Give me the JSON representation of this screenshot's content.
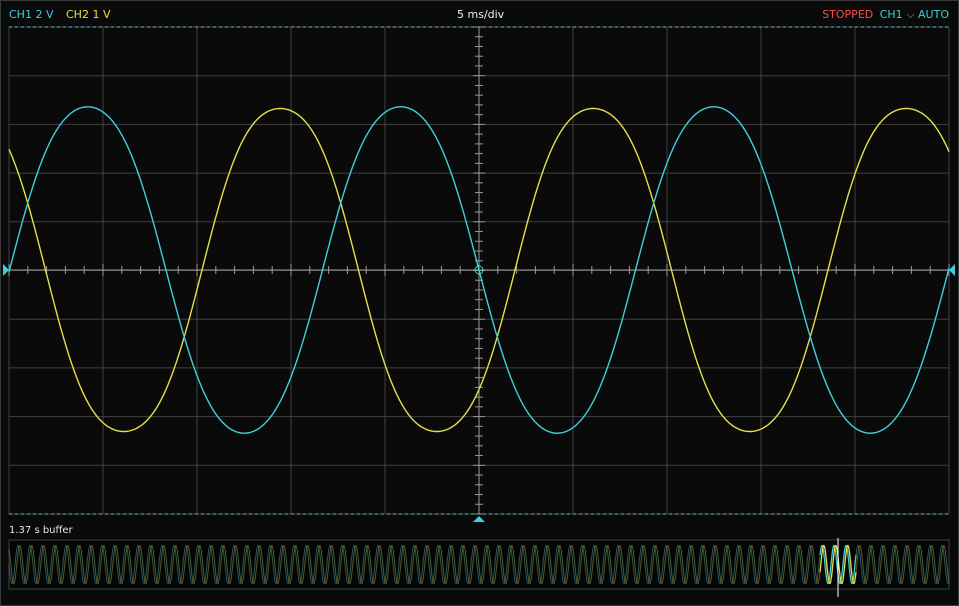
{
  "header": {
    "ch1_label": "CH1",
    "ch1_scale": "2 V",
    "ch2_label": "CH2",
    "ch2_scale": "1 V",
    "timebase": "5 ms/div",
    "run_state": "STOPPED",
    "trigger_source": "CH1",
    "trigger_slope_icon": "falling-edge-icon",
    "trigger_slope_glyph": "⌵",
    "trigger_mode": "AUTO"
  },
  "colors": {
    "ch1": "#3fd0dc",
    "ch2": "#e6e04a",
    "stopped": "#ff4a4a",
    "grid": "#404040",
    "marker": "#3fd0dc"
  },
  "buffer": {
    "label": "1.37 s buffer"
  }
}
